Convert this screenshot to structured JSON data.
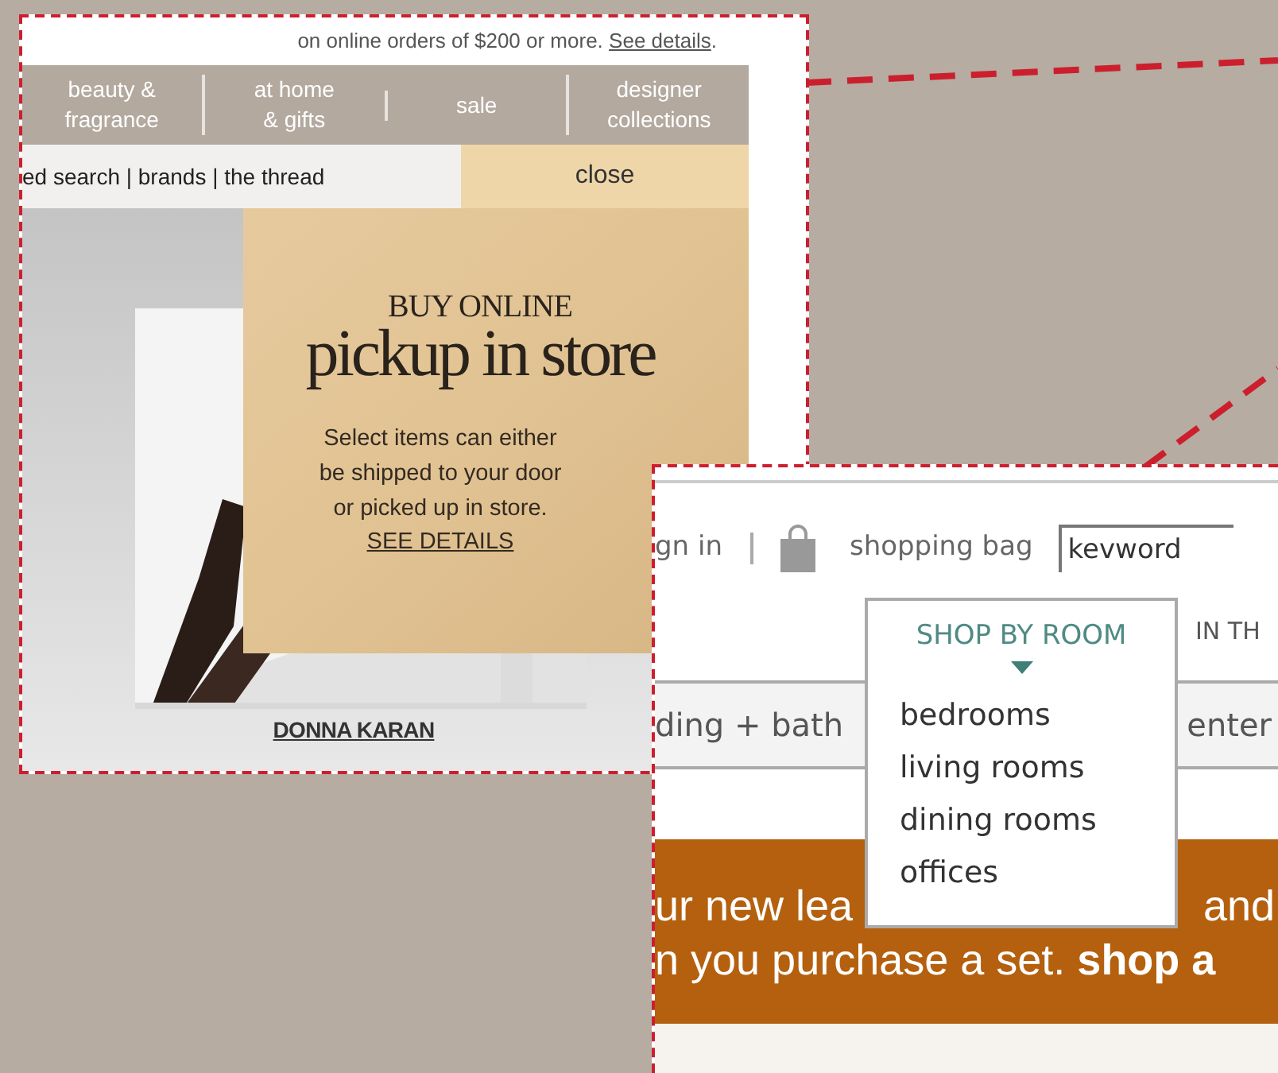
{
  "promo_screenshot": {
    "shipping_note": {
      "text": "on online orders of $200 or more.",
      "link": "See details",
      "end": "."
    },
    "nav": [
      {
        "label": "beauty &\nfragrance"
      },
      {
        "label": "at home\n& gifts"
      },
      {
        "label": "sale"
      },
      {
        "label": "designer\ncollections"
      }
    ],
    "links": "ed search | brands | the thread",
    "close_button": "close",
    "popup": {
      "kicker": "BUY ONLINE",
      "headline": "pickup in store",
      "body": "Select items can either\nbe shipped to your door\nor picked up in store.",
      "link": "SEE DETAILS"
    },
    "product_caption": "DONNA KARAN"
  },
  "furniture_screenshot": {
    "account_link": "gn in",
    "bag_link": "shopping bag",
    "search": {
      "value": "kevword"
    },
    "nav_tab": "IN TH",
    "categories": [
      "ding + bath",
      "enter"
    ],
    "dropdown": {
      "title": "SHOP BY ROOM",
      "expanded": true,
      "items": [
        "bedrooms",
        "living rooms",
        "dining rooms",
        "offices"
      ]
    },
    "banner": {
      "line_1_left": "ur new lea",
      "line_1_right": "and",
      "line_2": "n you purchase a set. **shop a**"
    }
  }
}
